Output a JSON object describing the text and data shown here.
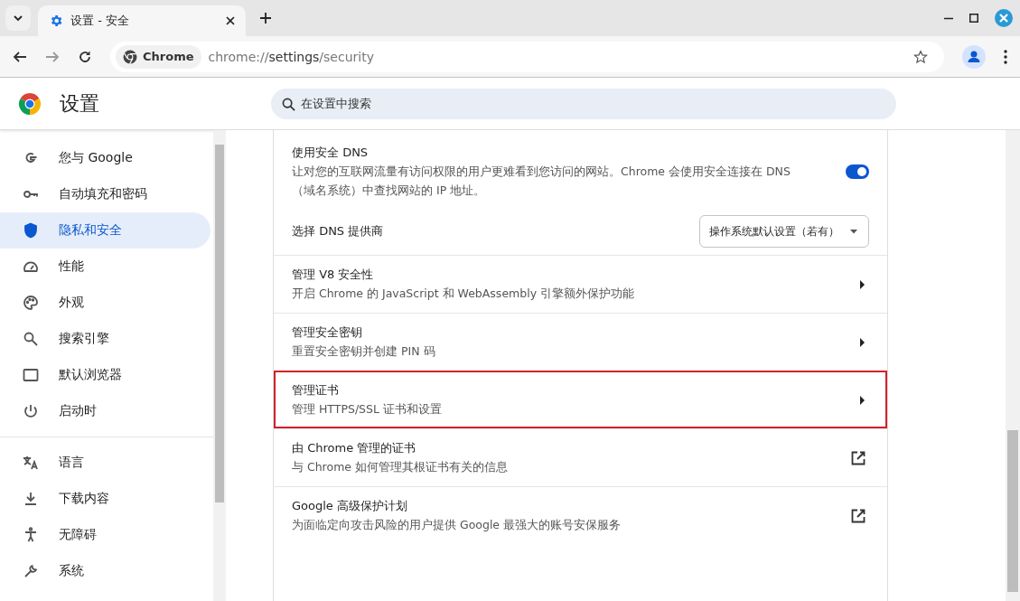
{
  "tab_strip": {
    "tabs": [
      {
        "title": "设置 - 安全",
        "selected": true
      }
    ]
  },
  "toolbar": {
    "site_chip": "Chrome",
    "url": {
      "scheme": "chrome://",
      "host": "settings",
      "path": "/security"
    }
  },
  "header": {
    "title": "设置",
    "search": {
      "placeholder": "在设置中搜索"
    }
  },
  "sidebar": {
    "items": [
      {
        "label": "您与 Google",
        "selected": false
      },
      {
        "label": "自动填充和密码",
        "selected": false
      },
      {
        "label": "隐私和安全",
        "selected": true
      },
      {
        "label": "性能",
        "selected": false
      },
      {
        "label": "外观",
        "selected": false
      },
      {
        "label": "搜索引擎",
        "selected": false
      },
      {
        "label": "默认浏览器",
        "selected": false
      },
      {
        "label": "启动时",
        "selected": false
      }
    ],
    "items_2": [
      {
        "label": "语言",
        "selected": false
      },
      {
        "label": "下载内容",
        "selected": false
      },
      {
        "label": "无障碍",
        "selected": false
      },
      {
        "label": "系统",
        "selected": false
      }
    ]
  },
  "settings": [
    {
      "kind": "toggle",
      "title": "使用安全 DNS",
      "description": "让对您的互联网流量有访问权限的用户更难看到您访问的网站。Chrome 会使用安全连接在 DNS（域名系统）中查找网站的 IP 地址。",
      "on": true
    },
    {
      "kind": "dropdown",
      "title": "选择 DNS 提供商",
      "value": "操作系统默认设置（若有）"
    },
    {
      "kind": "submenu",
      "title": "管理 V8 安全性",
      "description": "开启 Chrome 的 JavaScript 和 WebAssembly 引擎额外保护功能",
      "highlighted": false
    },
    {
      "kind": "submenu",
      "title": "管理安全密钥",
      "description": "重置安全密钥并创建 PIN 码",
      "highlighted": false
    },
    {
      "kind": "submenu",
      "title": "管理证书",
      "description": "管理 HTTPS/SSL 证书和设置",
      "highlighted": true
    },
    {
      "kind": "external",
      "title": "由 Chrome 管理的证书",
      "description": "与 Chrome 如何管理其根证书有关的信息",
      "highlighted": false
    },
    {
      "kind": "external",
      "title": "Google 高级保护计划",
      "description": "为面临定向攻击风险的用户提供 Google 最强大的账号安保服务",
      "highlighted": false
    }
  ]
}
